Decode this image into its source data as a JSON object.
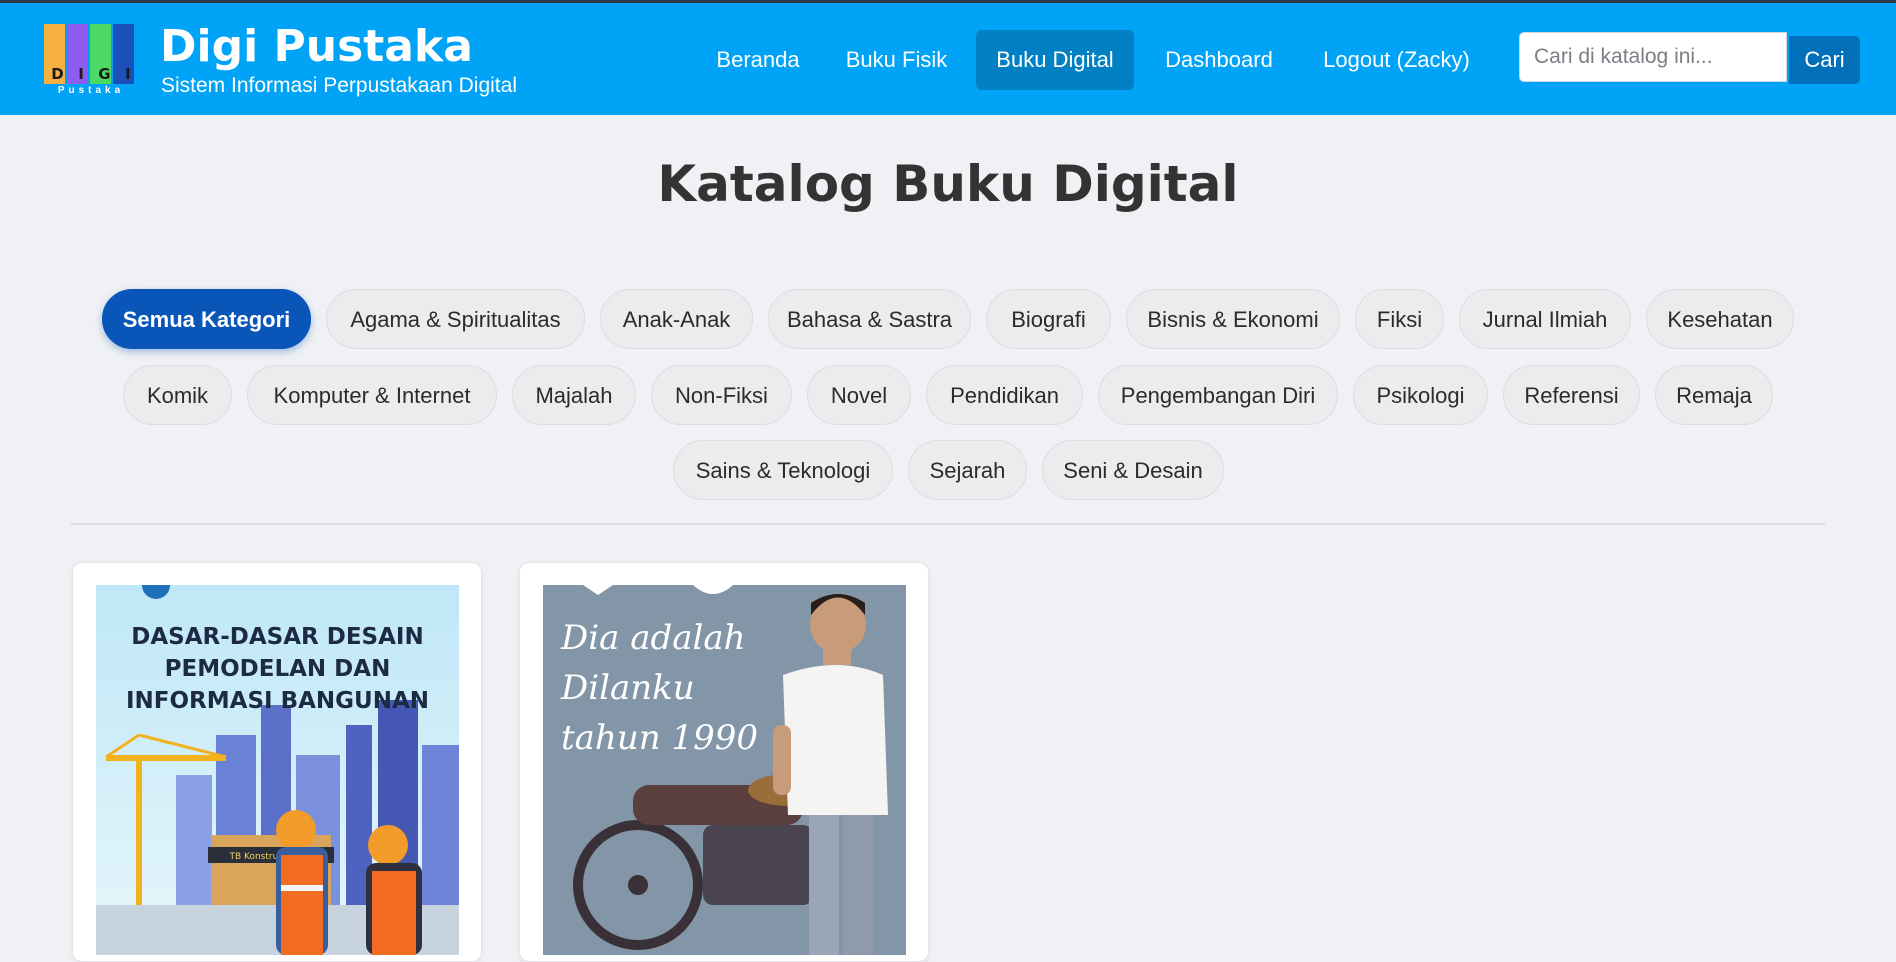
{
  "header": {
    "brand_title": "Digi Pustaka",
    "brand_subtitle": "Sistem Informasi Perpustakaan Digital",
    "logo": {
      "letters": [
        "D",
        "I",
        "G",
        "I"
      ],
      "caption": "Pustaka"
    },
    "nav": [
      {
        "label": "Beranda",
        "active": false
      },
      {
        "label": "Buku Fisik",
        "active": false
      },
      {
        "label": "Buku Digital",
        "active": true
      },
      {
        "label": "Dashboard",
        "active": false
      },
      {
        "label": "Logout (Zacky)",
        "active": false
      }
    ],
    "search": {
      "placeholder": "Cari di katalog ini...",
      "value": "",
      "button_label": "Cari"
    }
  },
  "page": {
    "title": "Katalog Buku Digital"
  },
  "categories": [
    {
      "label": "Semua Kategori",
      "active": true
    },
    {
      "label": "Agama & Spiritualitas"
    },
    {
      "label": "Anak-Anak"
    },
    {
      "label": "Bahasa & Sastra"
    },
    {
      "label": "Biografi"
    },
    {
      "label": "Bisnis & Ekonomi"
    },
    {
      "label": "Fiksi"
    },
    {
      "label": "Jurnal Ilmiah"
    },
    {
      "label": "Kesehatan"
    },
    {
      "label": "Komik"
    },
    {
      "label": "Komputer & Internet"
    },
    {
      "label": "Majalah"
    },
    {
      "label": "Non-Fiksi"
    },
    {
      "label": "Novel"
    },
    {
      "label": "Pendidikan"
    },
    {
      "label": "Pengembangan Diri"
    },
    {
      "label": "Psikologi"
    },
    {
      "label": "Referensi"
    },
    {
      "label": "Remaja"
    },
    {
      "label": "Sains & Teknologi"
    },
    {
      "label": "Sejarah"
    },
    {
      "label": "Seni & Desain"
    }
  ],
  "books": [
    {
      "cover_title": "DASAR-DASAR DESAIN PEMODELAN DAN INFORMASI BANGUNAN",
      "cover_sign": "TB Konstruksi Jaya"
    },
    {
      "cover_lines": [
        "Dia adalah",
        "Dilanku",
        "tahun 1990"
      ]
    }
  ],
  "colors": {
    "header_bg": "#00a3f5",
    "nav_active_bg": "#0280c4",
    "pill_active_bg": "#0a56b8",
    "search_button_bg": "#0270b8",
    "page_bg": "#f0f1f4"
  }
}
